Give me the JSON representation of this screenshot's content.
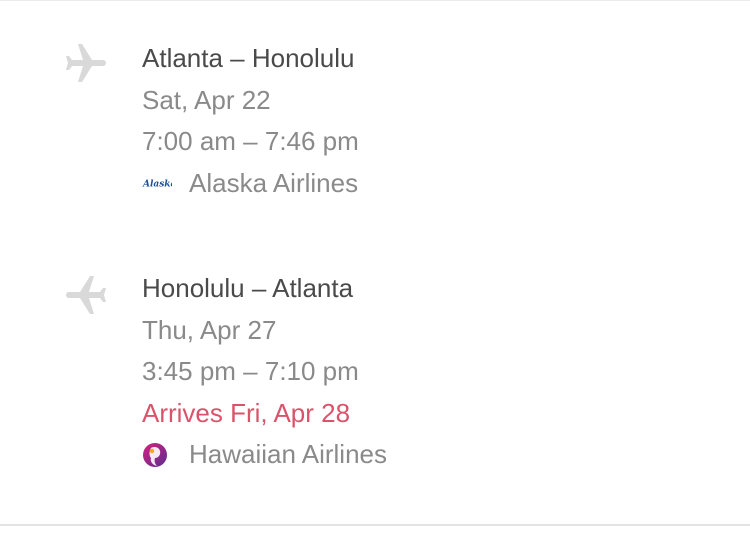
{
  "trip": {
    "legs": [
      {
        "route": "Atlanta – Honolulu",
        "date": "Sat, Apr 22",
        "times": "7:00 am – 7:46 pm",
        "airline": {
          "name": "Alaska Airlines",
          "logo_text": "Alaska",
          "logo_color": "#1d4f91"
        }
      },
      {
        "route": "Honolulu – Atlanta",
        "date": "Thu, Apr 27",
        "times": "3:45 pm – 7:10 pm",
        "arrival_note": "Arrives Fri, Apr 28",
        "airline": {
          "name": "Hawaiian Airlines",
          "logo_icon": "hawaiian-airlines-logo",
          "logo_color": "#5c2d91"
        }
      }
    ]
  },
  "colors": {
    "route_text": "#4a4a4a",
    "secondary_text": "#8a8a8a",
    "arrival_alert": "#d9546b",
    "plane_icon": "#d9d9d9"
  }
}
